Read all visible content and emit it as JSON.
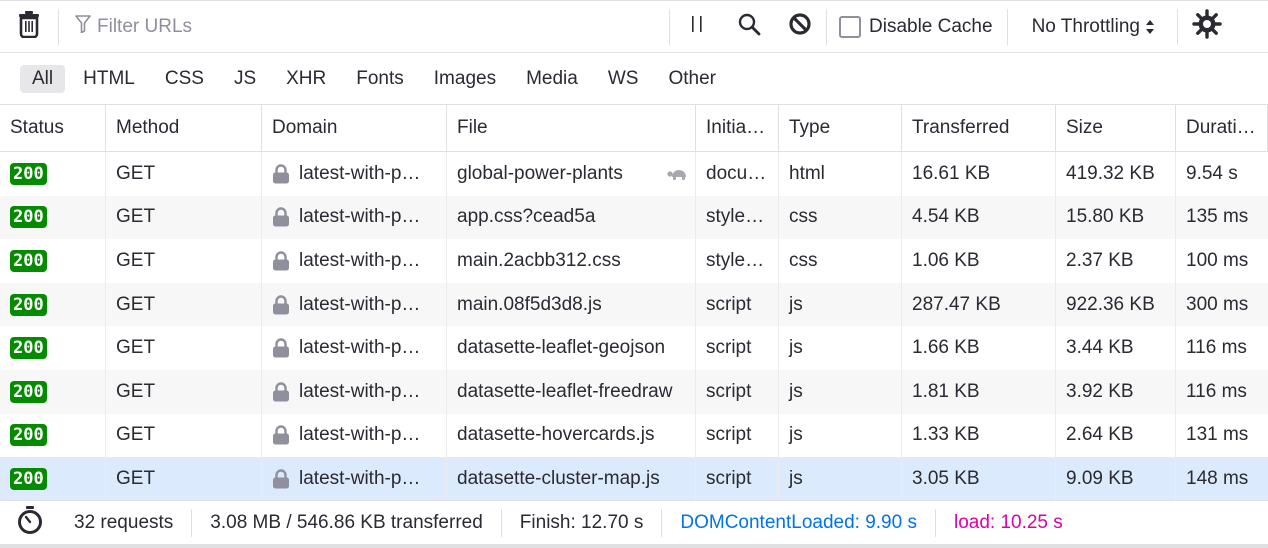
{
  "toolbar": {
    "filter_placeholder": "Filter URLs",
    "filter_value": "",
    "disable_cache_label": "Disable Cache",
    "disable_cache_checked": false,
    "throttling_value": "No Throttling",
    "icons": [
      "trash-icon",
      "filter-icon",
      "pause-icon",
      "search-icon",
      "block-icon",
      "settings-gear-icon"
    ]
  },
  "tabs": [
    {
      "label": "All",
      "active": true
    },
    {
      "label": "HTML",
      "active": false
    },
    {
      "label": "CSS",
      "active": false
    },
    {
      "label": "JS",
      "active": false
    },
    {
      "label": "XHR",
      "active": false
    },
    {
      "label": "Fonts",
      "active": false
    },
    {
      "label": "Images",
      "active": false
    },
    {
      "label": "Media",
      "active": false
    },
    {
      "label": "WS",
      "active": false
    },
    {
      "label": "Other",
      "active": false
    }
  ],
  "table": {
    "columns": [
      "Status",
      "Method",
      "Domain",
      "File",
      "Initia…",
      "Type",
      "Transferred",
      "Size",
      "Durati…"
    ],
    "rows": [
      {
        "status": "200",
        "method": "GET",
        "domain": "latest-with-p…",
        "file": "global-power-plants",
        "slow": true,
        "initiator": "docu…",
        "type": "html",
        "transferred": "16.61 KB",
        "size": "419.32 KB",
        "duration": "9.54 s"
      },
      {
        "status": "200",
        "method": "GET",
        "domain": "latest-with-p…",
        "file": "app.css?cead5a",
        "slow": false,
        "initiator": "style…",
        "type": "css",
        "transferred": "4.54 KB",
        "size": "15.80 KB",
        "duration": "135 ms"
      },
      {
        "status": "200",
        "method": "GET",
        "domain": "latest-with-p…",
        "file": "main.2acbb312.css",
        "slow": false,
        "initiator": "style…",
        "type": "css",
        "transferred": "1.06 KB",
        "size": "2.37 KB",
        "duration": "100 ms"
      },
      {
        "status": "200",
        "method": "GET",
        "domain": "latest-with-p…",
        "file": "main.08f5d3d8.js",
        "slow": false,
        "initiator": "script",
        "type": "js",
        "transferred": "287.47 KB",
        "size": "922.36 KB",
        "duration": "300 ms"
      },
      {
        "status": "200",
        "method": "GET",
        "domain": "latest-with-p…",
        "file": "datasette-leaflet-geojson",
        "slow": false,
        "initiator": "script",
        "type": "js",
        "transferred": "1.66 KB",
        "size": "3.44 KB",
        "duration": "116 ms"
      },
      {
        "status": "200",
        "method": "GET",
        "domain": "latest-with-p…",
        "file": "datasette-leaflet-freedraw",
        "slow": false,
        "initiator": "script",
        "type": "js",
        "transferred": "1.81 KB",
        "size": "3.92 KB",
        "duration": "116 ms"
      },
      {
        "status": "200",
        "method": "GET",
        "domain": "latest-with-p…",
        "file": "datasette-hovercards.js",
        "slow": false,
        "initiator": "script",
        "type": "js",
        "transferred": "1.33 KB",
        "size": "2.64 KB",
        "duration": "131 ms"
      },
      {
        "status": "200",
        "method": "GET",
        "domain": "latest-with-p…",
        "file": "datasette-cluster-map.js",
        "slow": false,
        "initiator": "script",
        "type": "js",
        "transferred": "3.05 KB",
        "size": "9.09 KB",
        "duration": "148 ms",
        "selected": true
      }
    ]
  },
  "statusbar": {
    "requests": "32 requests",
    "transferred": "3.08 MB / 546.86 KB transferred",
    "finish": "Finish: 12.70 s",
    "dom_content_loaded": "DOMContentLoaded: 9.90 s",
    "load": "load: 10.25 s",
    "colors": {
      "dom_content_loaded": "#0074e8",
      "load": "#dd00a9"
    }
  },
  "colors": {
    "status_ok": "#058b00",
    "selected_row": "#dbeafc"
  }
}
